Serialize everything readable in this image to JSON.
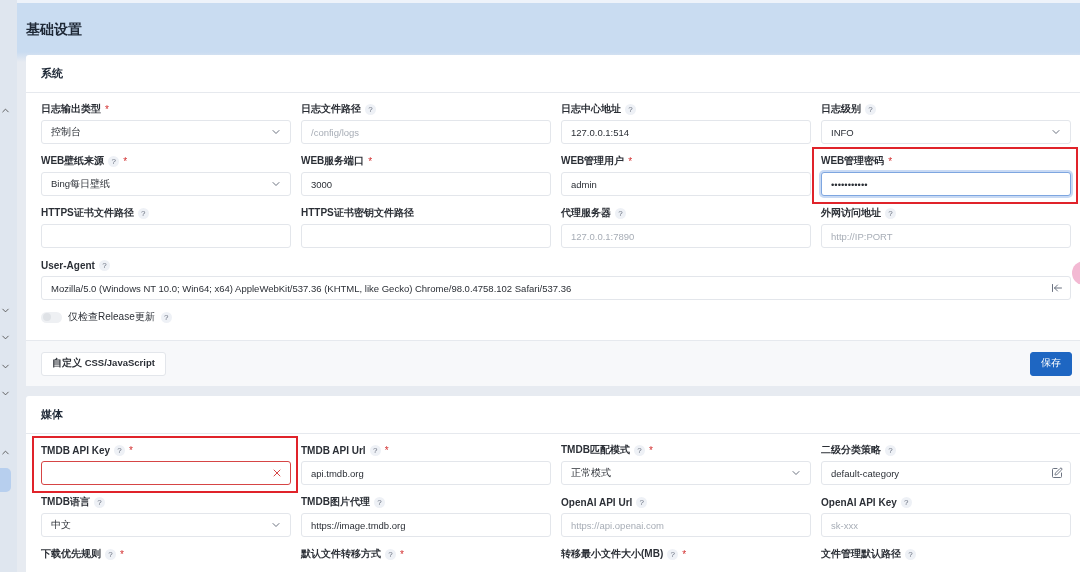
{
  "page_title": "基础设置",
  "sidebar": [
    {
      "kind": "toggle",
      "expanded": true
    },
    {
      "kind": "toggle",
      "expanded": false
    },
    {
      "kind": "toggle",
      "expanded": false
    },
    {
      "kind": "toggle",
      "expanded": false
    },
    {
      "kind": "toggle",
      "expanded": false
    },
    {
      "kind": "toggle",
      "expanded": true
    },
    {
      "kind": "item",
      "selected": true
    }
  ],
  "sections": [
    {
      "title": "系统",
      "fields": [
        {
          "label": "日志输出类型",
          "required": "*",
          "kind": "select",
          "value": "控制台"
        },
        {
          "label": "日志文件路径",
          "help": "?",
          "kind": "text",
          "placeholder": "/config/logs"
        },
        {
          "label": "日志中心地址",
          "help": "?",
          "kind": "text",
          "value": "127.0.0.1:514"
        },
        {
          "label": "日志级别",
          "help": "?",
          "kind": "select",
          "value": "INFO"
        },
        {
          "label": "WEB壁纸来源",
          "help": "?",
          "required": "*",
          "kind": "select",
          "value": "Bing每日壁纸"
        },
        {
          "label": "WEB服务端口",
          "required": "*",
          "kind": "text",
          "value": "3000"
        },
        {
          "label": "WEB管理用户",
          "required": "*",
          "kind": "text",
          "value": "admin"
        },
        {
          "label": "WEB管理密码",
          "required": "*",
          "kind": "password",
          "value": "•••••••••••",
          "highlighted": true,
          "focused": true
        },
        {
          "label": "HTTPS证书文件路径",
          "help": "?",
          "kind": "text"
        },
        {
          "label": "HTTPS证书密钥文件路径",
          "kind": "text"
        },
        {
          "label": "代理服务器",
          "help": "?",
          "kind": "text",
          "placeholder": "127.0.0.1:7890"
        },
        {
          "label": "外网访问地址",
          "help": "?",
          "kind": "text",
          "placeholder": "http://IP:PORT"
        },
        {
          "label": "User-Agent",
          "help": "?",
          "kind": "reset",
          "value": "Mozilla/5.0 (Windows NT 10.0; Win64; x64) AppleWebKit/537.36 (KHTML, like Gecko) Chrome/98.0.4758.102 Safari/537.36"
        }
      ],
      "switch": {
        "label": "仅检查Release更新",
        "help": "?",
        "checked": false
      },
      "buttons": [
        {
          "label": "自定义 CSS/JavaScript",
          "kind": "secondary"
        },
        {
          "label": "保存",
          "kind": "primary"
        }
      ]
    },
    {
      "title": "媒体",
      "fields": [
        {
          "label": "TMDB API Key",
          "help": "?",
          "required": "*",
          "kind": "clearable",
          "highlighted": true,
          "invalid": true
        },
        {
          "label": "TMDB API Url",
          "help": "?",
          "required": "*",
          "kind": "text",
          "value": "api.tmdb.org"
        },
        {
          "label": "TMDB匹配模式",
          "help": "?",
          "required": "*",
          "kind": "select",
          "value": "正常模式"
        },
        {
          "label": "二级分类策略",
          "help": "?",
          "kind": "editable",
          "value": "default-category"
        },
        {
          "label": "TMDB语言",
          "help": "?",
          "kind": "select",
          "value": "中文"
        },
        {
          "label": "TMDB图片代理",
          "help": "?",
          "kind": "text",
          "value": "https://image.tmdb.org"
        },
        {
          "label": "OpenAI API Url",
          "help": "?",
          "kind": "text",
          "placeholder": "https://api.openai.com"
        },
        {
          "label": "OpenAI API Key",
          "help": "?",
          "kind": "text",
          "placeholder": "sk-xxx"
        },
        {
          "label": "下载优先规则",
          "help": "?",
          "required": "*",
          "kind": "label-only"
        },
        {
          "label": "默认文件转移方式",
          "help": "?",
          "required": "*",
          "kind": "label-only"
        },
        {
          "label": "转移最小文件大小(MB)",
          "help": "?",
          "required": "*",
          "kind": "label-only"
        },
        {
          "label": "文件管理默认路径",
          "help": "?",
          "kind": "label-only"
        }
      ]
    }
  ]
}
